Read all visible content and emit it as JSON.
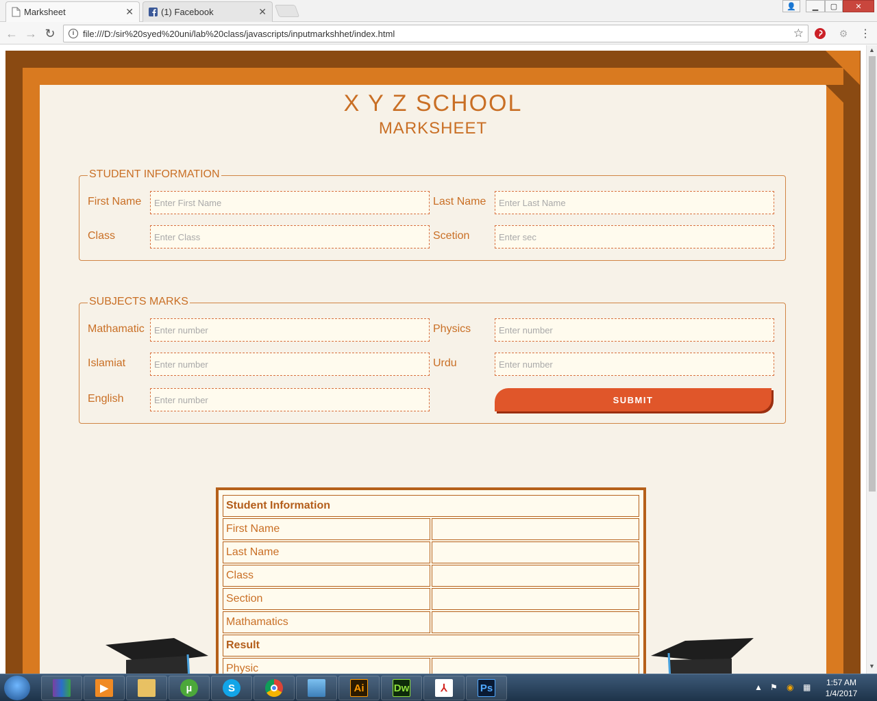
{
  "browser": {
    "tabs": [
      {
        "title": "Marksheet",
        "active": true
      },
      {
        "title": "(1) Facebook",
        "active": false
      }
    ],
    "url": "file:///D:/sir%20syed%20uni/lab%20class/javascripts/inputmarkshhet/index.html"
  },
  "page": {
    "school_title": "X Y Z SCHOOL",
    "sheet_title": "MARKSHEET",
    "student_info": {
      "legend": "STUDENT INFORMATION",
      "first_name_label": "First Name",
      "first_name_placeholder": "Enter First Name",
      "last_name_label": "Last Name",
      "last_name_placeholder": "Enter Last Name",
      "class_label": "Class",
      "class_placeholder": "Enter Class",
      "section_label": "Scetion",
      "section_placeholder": "Enter sec"
    },
    "subjects": {
      "legend": "SUBJECTS MARKS",
      "math_label": "Mathamatic",
      "physics_label": "Physics",
      "islamiat_label": "Islamiat",
      "urdu_label": "Urdu",
      "english_label": "English",
      "placeholder": "Enter number",
      "submit_label": "SUBMIT"
    },
    "result_table": {
      "student_header": "Student Information",
      "rows": [
        "First Name",
        "Last Name",
        "Class",
        "Section",
        "Mathamatics"
      ],
      "result_header": "Result",
      "partial_row": "Physic"
    }
  },
  "taskbar": {
    "apps": [
      "WinRAR",
      "Media Player",
      "File Explorer",
      "uTorrent",
      "Skype",
      "Chrome",
      "Photo Viewer",
      "Illustrator",
      "Dreamweaver",
      "Acrobat",
      "Photoshop"
    ],
    "illustrator_label": "Ai",
    "dreamweaver_label": "Dw",
    "photoshop_label": "Ps",
    "time": "1:57 AM",
    "date": "1/4/2017"
  },
  "colors": {
    "frame_dark": "#8a4a12",
    "frame_mid": "#d97a20",
    "paper": "#f7f2e8",
    "accent_text": "#c96f25",
    "submit_button": "#e0562a"
  }
}
